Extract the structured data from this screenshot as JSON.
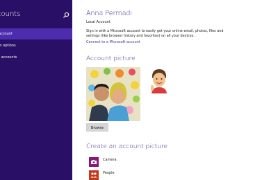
{
  "sidebar": {
    "title": "counts",
    "items": [
      {
        "label": "account",
        "active": true
      },
      {
        "label": "in options",
        "active": false
      },
      {
        "label": "r accounts",
        "active": false
      }
    ]
  },
  "main": {
    "user_name": "Anna Permadi",
    "account_type": "Local Account",
    "description": "Sign in with a Microsoft account to easily get your online email, photos, files and settings (like browser history and favorites) on all your devices.",
    "connect_link": "Connect to a Microsoft account",
    "account_picture_title": "Account picture",
    "browse_label": "Browse",
    "create_title": "Create an account picture",
    "create_items": [
      {
        "label": "Camera",
        "icon": "camera-icon"
      },
      {
        "label": "People",
        "icon": "people-icon"
      }
    ]
  },
  "colors": {
    "sidebar_bg": "#2a0f66",
    "sidebar_active": "#4d2cb0",
    "accent": "#3c2380",
    "camera_tile": "#8a1a7a",
    "people_tile": "#c4391c"
  }
}
